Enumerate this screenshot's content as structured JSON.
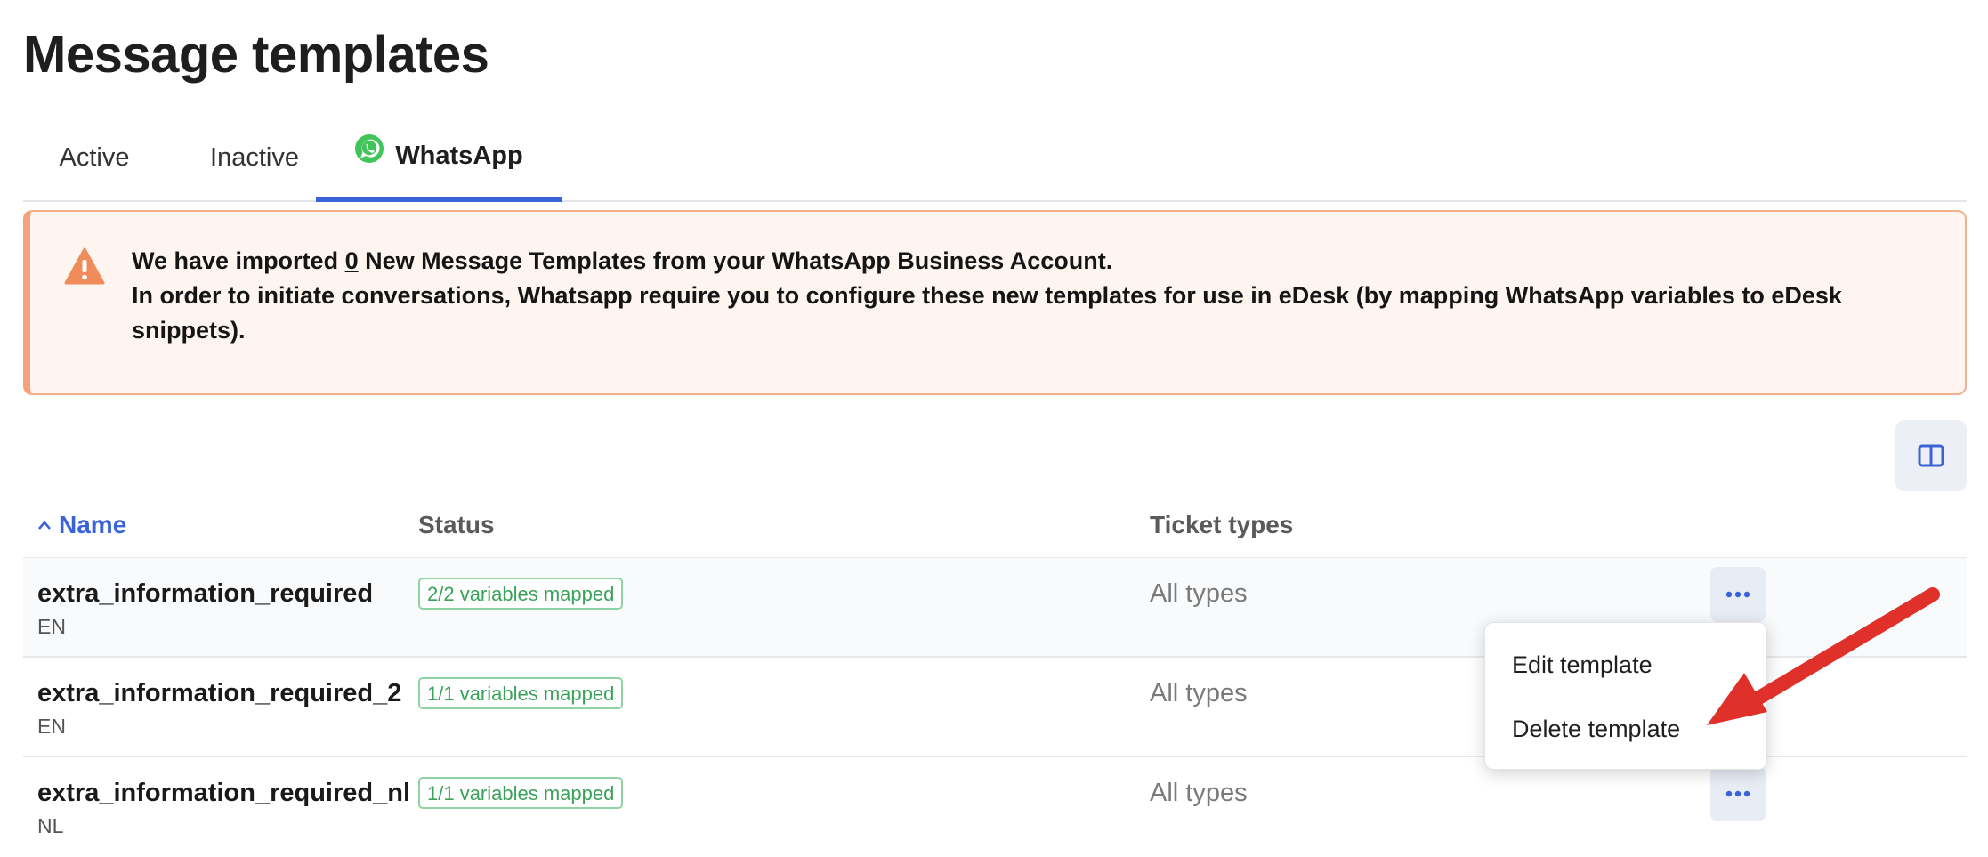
{
  "page": {
    "title": "Message templates"
  },
  "tabs": [
    {
      "label": "Active"
    },
    {
      "label": "Inactive"
    },
    {
      "label": "WhatsApp",
      "icon": "whatsapp-icon",
      "active": true
    }
  ],
  "alert": {
    "icon": "warning-icon",
    "line1_prefix": "We have imported ",
    "count": "0",
    "line1_suffix": " New Message Templates from your WhatsApp Business Account.",
    "line2": "In order to initiate conversations, Whatsapp require you to configure these new templates for use in eDesk (by mapping WhatsApp variables to eDesk snippets)."
  },
  "toolbar": {
    "columns_icon": "columns-icon"
  },
  "table": {
    "headers": {
      "name": "Name",
      "status": "Status",
      "ticket_types": "Ticket types"
    },
    "rows": [
      {
        "name": "extra_information_required",
        "lang": "EN",
        "status": "2/2 variables mapped",
        "ticket_types": "All types"
      },
      {
        "name": "extra_information_required_2",
        "lang": "EN",
        "status": "1/1 variables mapped",
        "ticket_types": "All types"
      },
      {
        "name": "extra_information_required_nl",
        "lang": "NL",
        "status": "1/1 variables mapped",
        "ticket_types": "All types"
      }
    ]
  },
  "row_menu": {
    "edit": "Edit template",
    "delete": "Delete template"
  },
  "colors": {
    "accent": "#3b63d8",
    "success": "#3aa35a",
    "warning": "#ef8c5a",
    "annotation": "#e0302a"
  }
}
